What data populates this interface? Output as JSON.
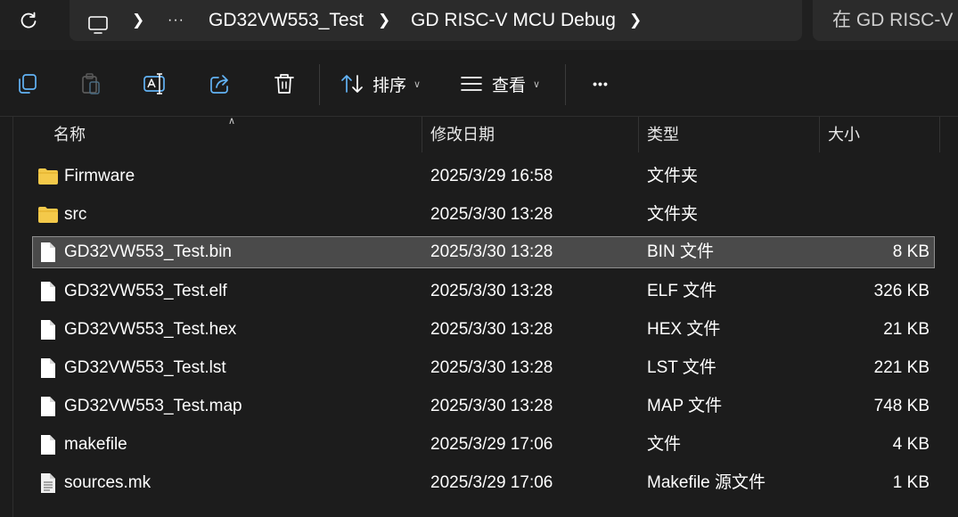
{
  "breadcrumb": {
    "ellipsis": "···",
    "items": [
      "GD32VW553_Test",
      "GD RISC-V MCU Debug"
    ]
  },
  "search": {
    "placeholder": "在 GD RISC-V MCU Debug 中搜索"
  },
  "toolbar": {
    "sort_label": "排序",
    "view_label": "查看",
    "more_label": "•••"
  },
  "columns": {
    "name": "名称",
    "modified": "修改日期",
    "type": "类型",
    "size": "大小"
  },
  "files": [
    {
      "icon": "folder-icon",
      "name": "Firmware",
      "modified": "2025/3/29 16:58",
      "type": "文件夹",
      "size": ""
    },
    {
      "icon": "folder-icon",
      "name": "src",
      "modified": "2025/3/30 13:28",
      "type": "文件夹",
      "size": ""
    },
    {
      "icon": "file-icon",
      "name": "GD32VW553_Test.bin",
      "modified": "2025/3/30 13:28",
      "type": "BIN 文件",
      "size": "8 KB",
      "selected": true
    },
    {
      "icon": "file-icon",
      "name": "GD32VW553_Test.elf",
      "modified": "2025/3/30 13:28",
      "type": "ELF 文件",
      "size": "326 KB"
    },
    {
      "icon": "file-icon",
      "name": "GD32VW553_Test.hex",
      "modified": "2025/3/30 13:28",
      "type": "HEX 文件",
      "size": "21 KB"
    },
    {
      "icon": "file-icon",
      "name": "GD32VW553_Test.lst",
      "modified": "2025/3/30 13:28",
      "type": "LST 文件",
      "size": "221 KB"
    },
    {
      "icon": "file-icon",
      "name": "GD32VW553_Test.map",
      "modified": "2025/3/30 13:28",
      "type": "MAP 文件",
      "size": "748 KB"
    },
    {
      "icon": "file-icon",
      "name": "makefile",
      "modified": "2025/3/29 17:06",
      "type": "文件",
      "size": "4 KB"
    },
    {
      "icon": "text-file-icon",
      "name": "sources.mk",
      "modified": "2025/3/29 17:06",
      "type": "Makefile 源文件",
      "size": "1 KB"
    }
  ],
  "colors": {
    "background": "#1c1c1c",
    "selected_row": "#4a4a4a",
    "folder": "#f4c94a"
  }
}
